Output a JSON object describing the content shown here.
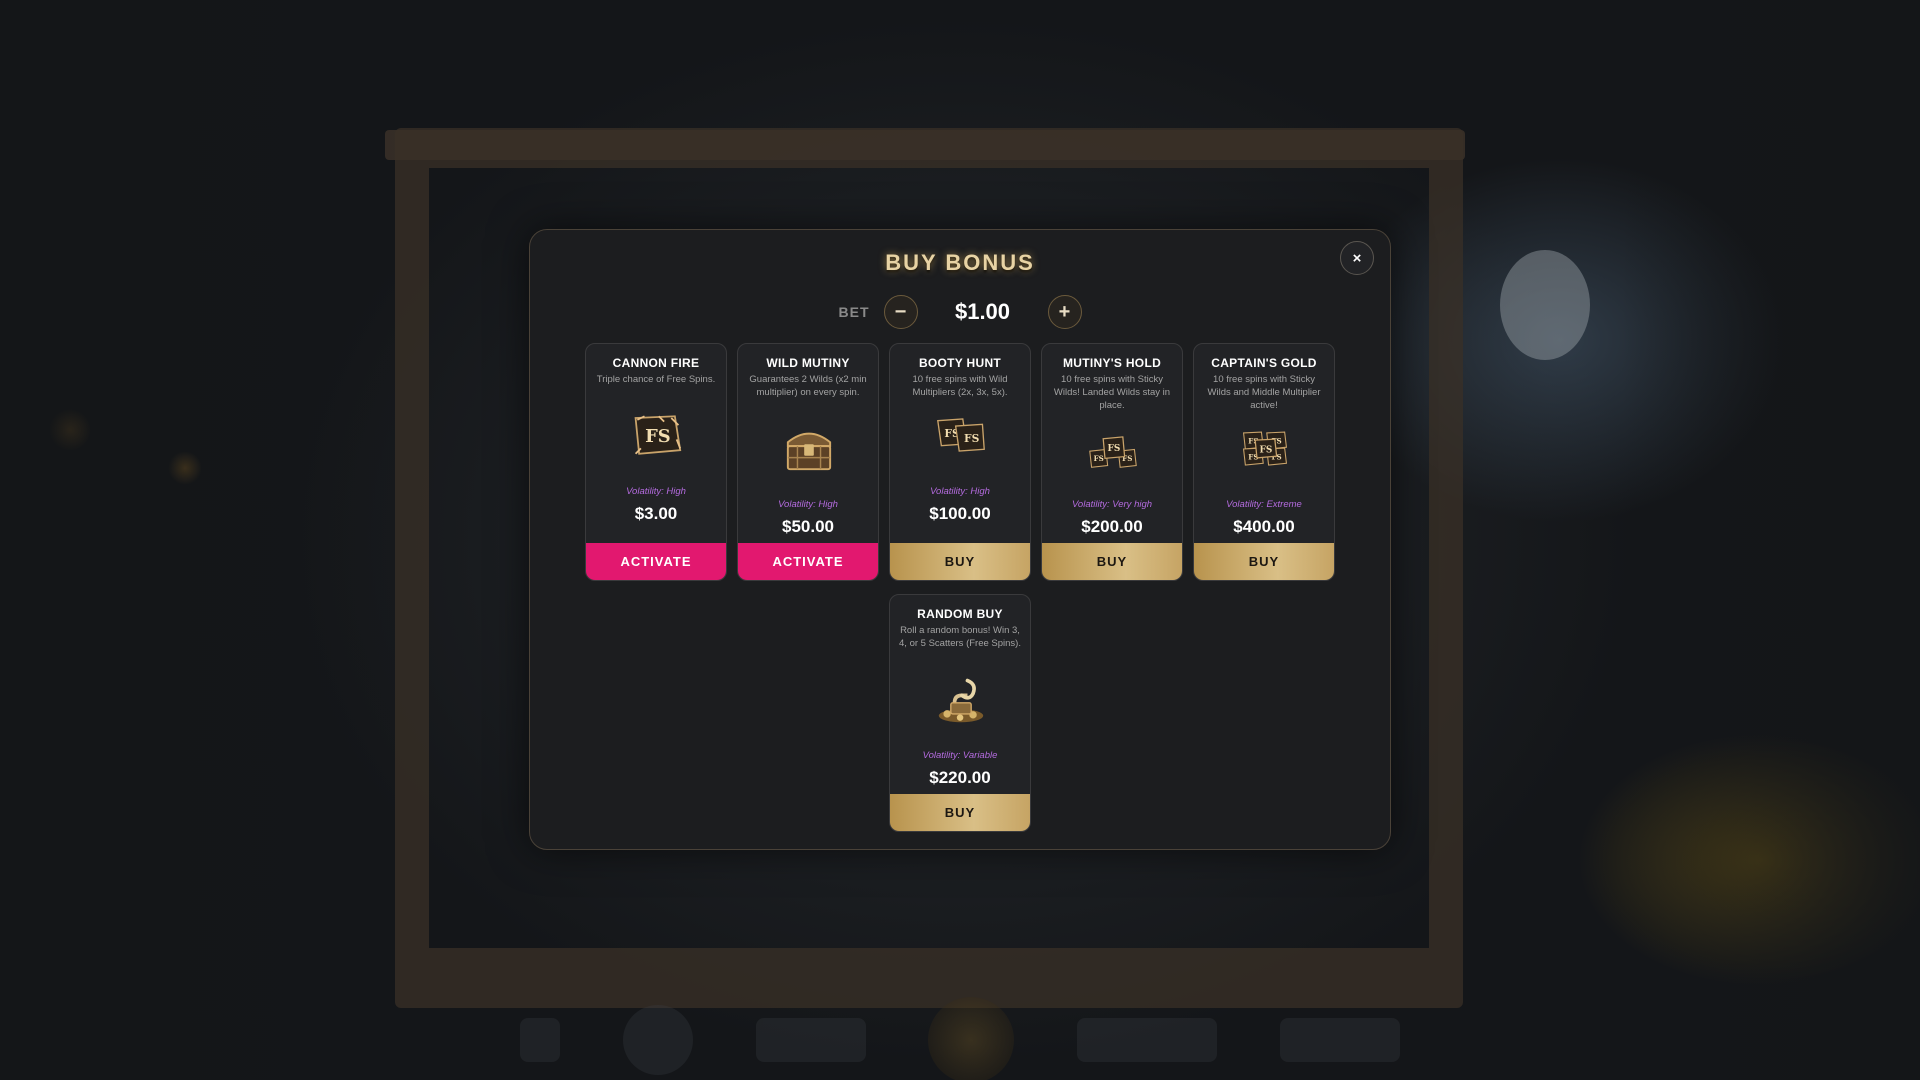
{
  "modal": {
    "title": "BUY BONUS",
    "close_label": "×",
    "bet_label": "BET",
    "bet_value": "$1.00",
    "decrease_label": "−",
    "increase_label": "+"
  },
  "cards": [
    {
      "title": "CANNON FIRE",
      "description": "Triple chance of Free Spins.",
      "icon": "fs-flag-icon",
      "volatility": "Volatility: High",
      "price": "$3.00",
      "button": "ACTIVATE",
      "button_style": "activate"
    },
    {
      "title": "WILD MUTINY",
      "description": "Guarantees 2 Wilds (x2 min multiplier) on every spin.",
      "icon": "treasure-chest-icon",
      "volatility": "Volatility: High",
      "price": "$50.00",
      "button": "ACTIVATE",
      "button_style": "activate"
    },
    {
      "title": "BOOTY HUNT",
      "description": "10 free spins with Wild Multipliers (2x, 3x, 5x).",
      "icon": "fs-flags-icon",
      "volatility": "Volatility: High",
      "price": "$100.00",
      "button": "BUY",
      "button_style": "buy"
    },
    {
      "title": "MUTINY'S HOLD",
      "description": "10 free spins with Sticky Wilds! Landed Wilds stay in place.",
      "icon": "fs-flags-triple-icon",
      "volatility": "Volatility: Very high",
      "price": "$200.00",
      "button": "BUY",
      "button_style": "buy"
    },
    {
      "title": "CAPTAIN'S GOLD",
      "description": "10 free spins with Sticky Wilds and Middle Multiplier active!",
      "icon": "fs-flags-quad-icon",
      "volatility": "Volatility: Extreme",
      "price": "$400.00",
      "button": "BUY",
      "button_style": "buy"
    },
    {
      "title": "RANDOM BUY",
      "description": "Roll a random bonus! Win 3, 4, or 5 Scatters (Free Spins).",
      "icon": "hook-treasure-icon",
      "volatility": "Volatility: Variable",
      "price": "$220.00",
      "button": "BUY",
      "button_style": "buy"
    }
  ],
  "colors": {
    "activate": "#e2186f",
    "buy_gold": "#d9bf86",
    "volatility": "#b46bdf",
    "title_glow": "#e8d3a4"
  }
}
